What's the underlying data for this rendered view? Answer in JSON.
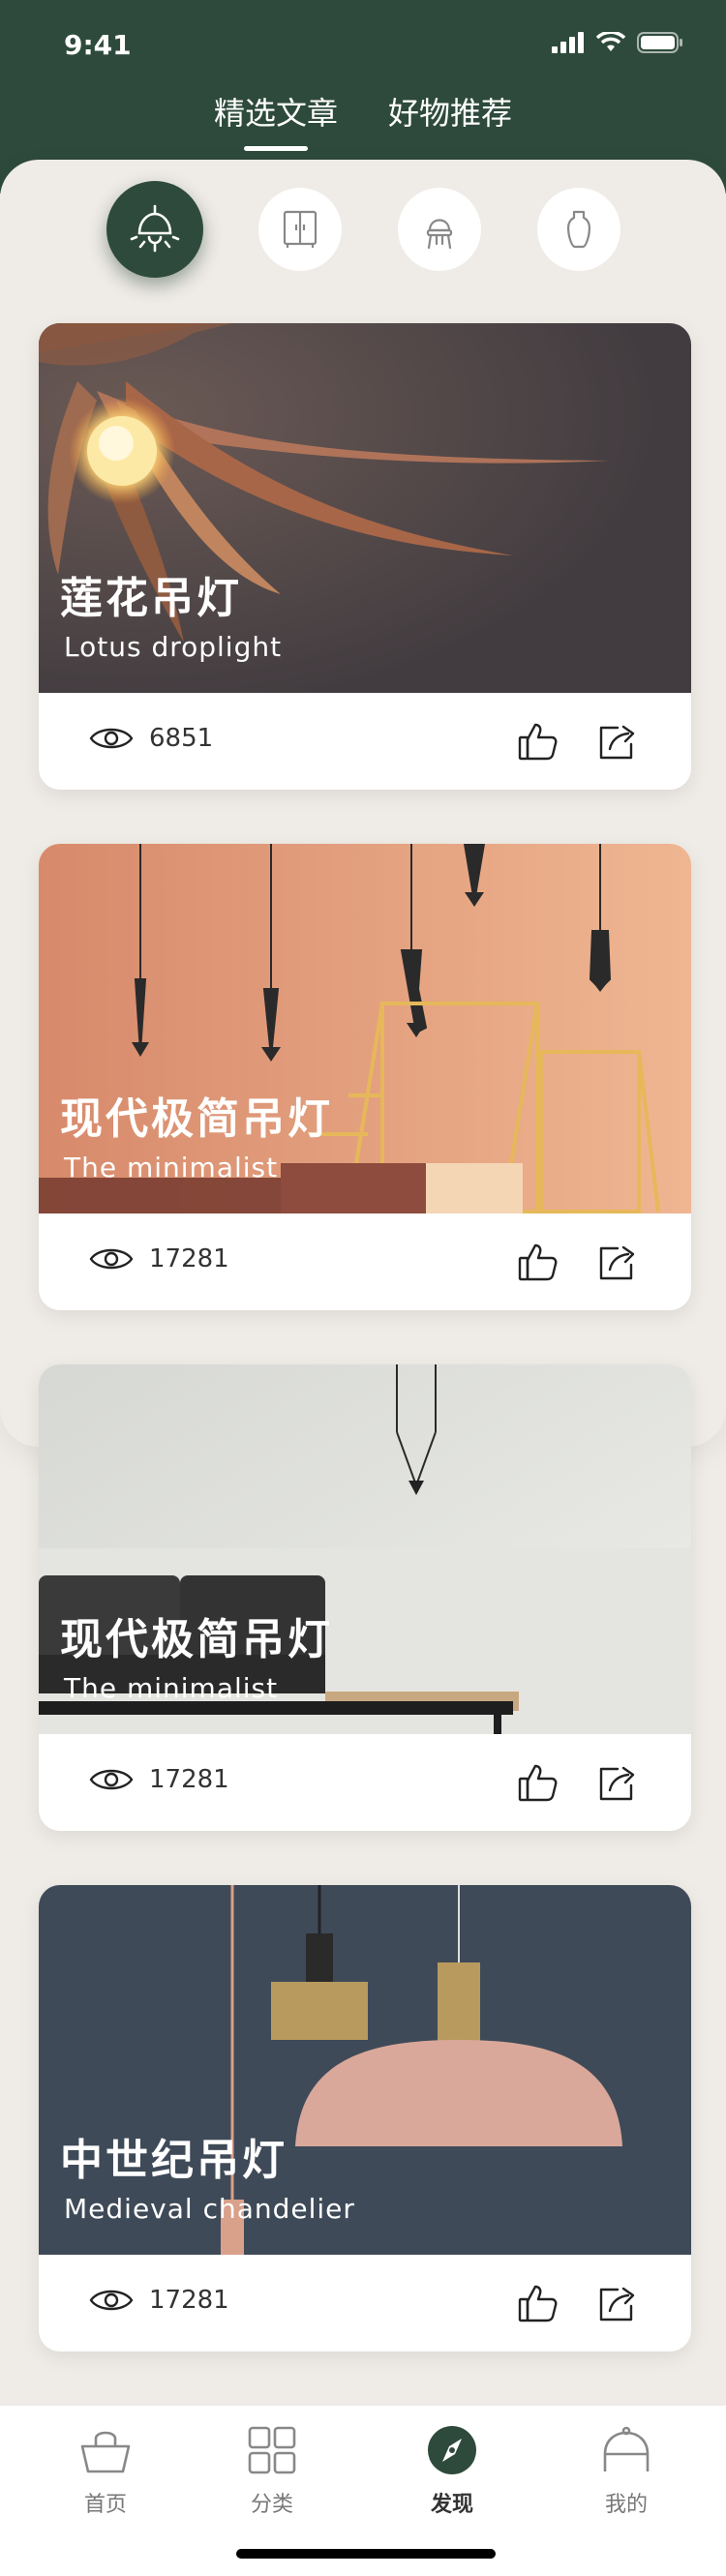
{
  "status": {
    "time": "9:41"
  },
  "top_tabs": [
    {
      "label": "精选文章",
      "active": true
    },
    {
      "label": "好物推荐",
      "active": false
    }
  ],
  "categories": [
    {
      "icon": "pendant-lamp-icon",
      "active": true
    },
    {
      "icon": "wardrobe-icon",
      "active": false
    },
    {
      "icon": "chair-icon",
      "active": false
    },
    {
      "icon": "vase-icon",
      "active": false
    }
  ],
  "cards": [
    {
      "title": "莲花吊灯",
      "subtitle": "Lotus droplight",
      "views": "6851"
    },
    {
      "title": "现代极简吊灯",
      "subtitle": "The minimalist",
      "views": "17281"
    },
    {
      "title": "现代极简吊灯",
      "subtitle": "The minimalist",
      "views": "17281"
    },
    {
      "title": "中世纪吊灯",
      "subtitle": "Medieval chandelier",
      "views": "17281"
    }
  ],
  "bottom_nav": [
    {
      "label": "首页",
      "icon": "bag-icon",
      "active": false
    },
    {
      "label": "分类",
      "icon": "grid-icon",
      "active": false
    },
    {
      "label": "发现",
      "icon": "compass-icon",
      "active": true
    },
    {
      "label": "我的",
      "icon": "user-icon",
      "active": false
    }
  ],
  "colors": {
    "primary": "#2e4a3c",
    "background": "#efebe6"
  }
}
